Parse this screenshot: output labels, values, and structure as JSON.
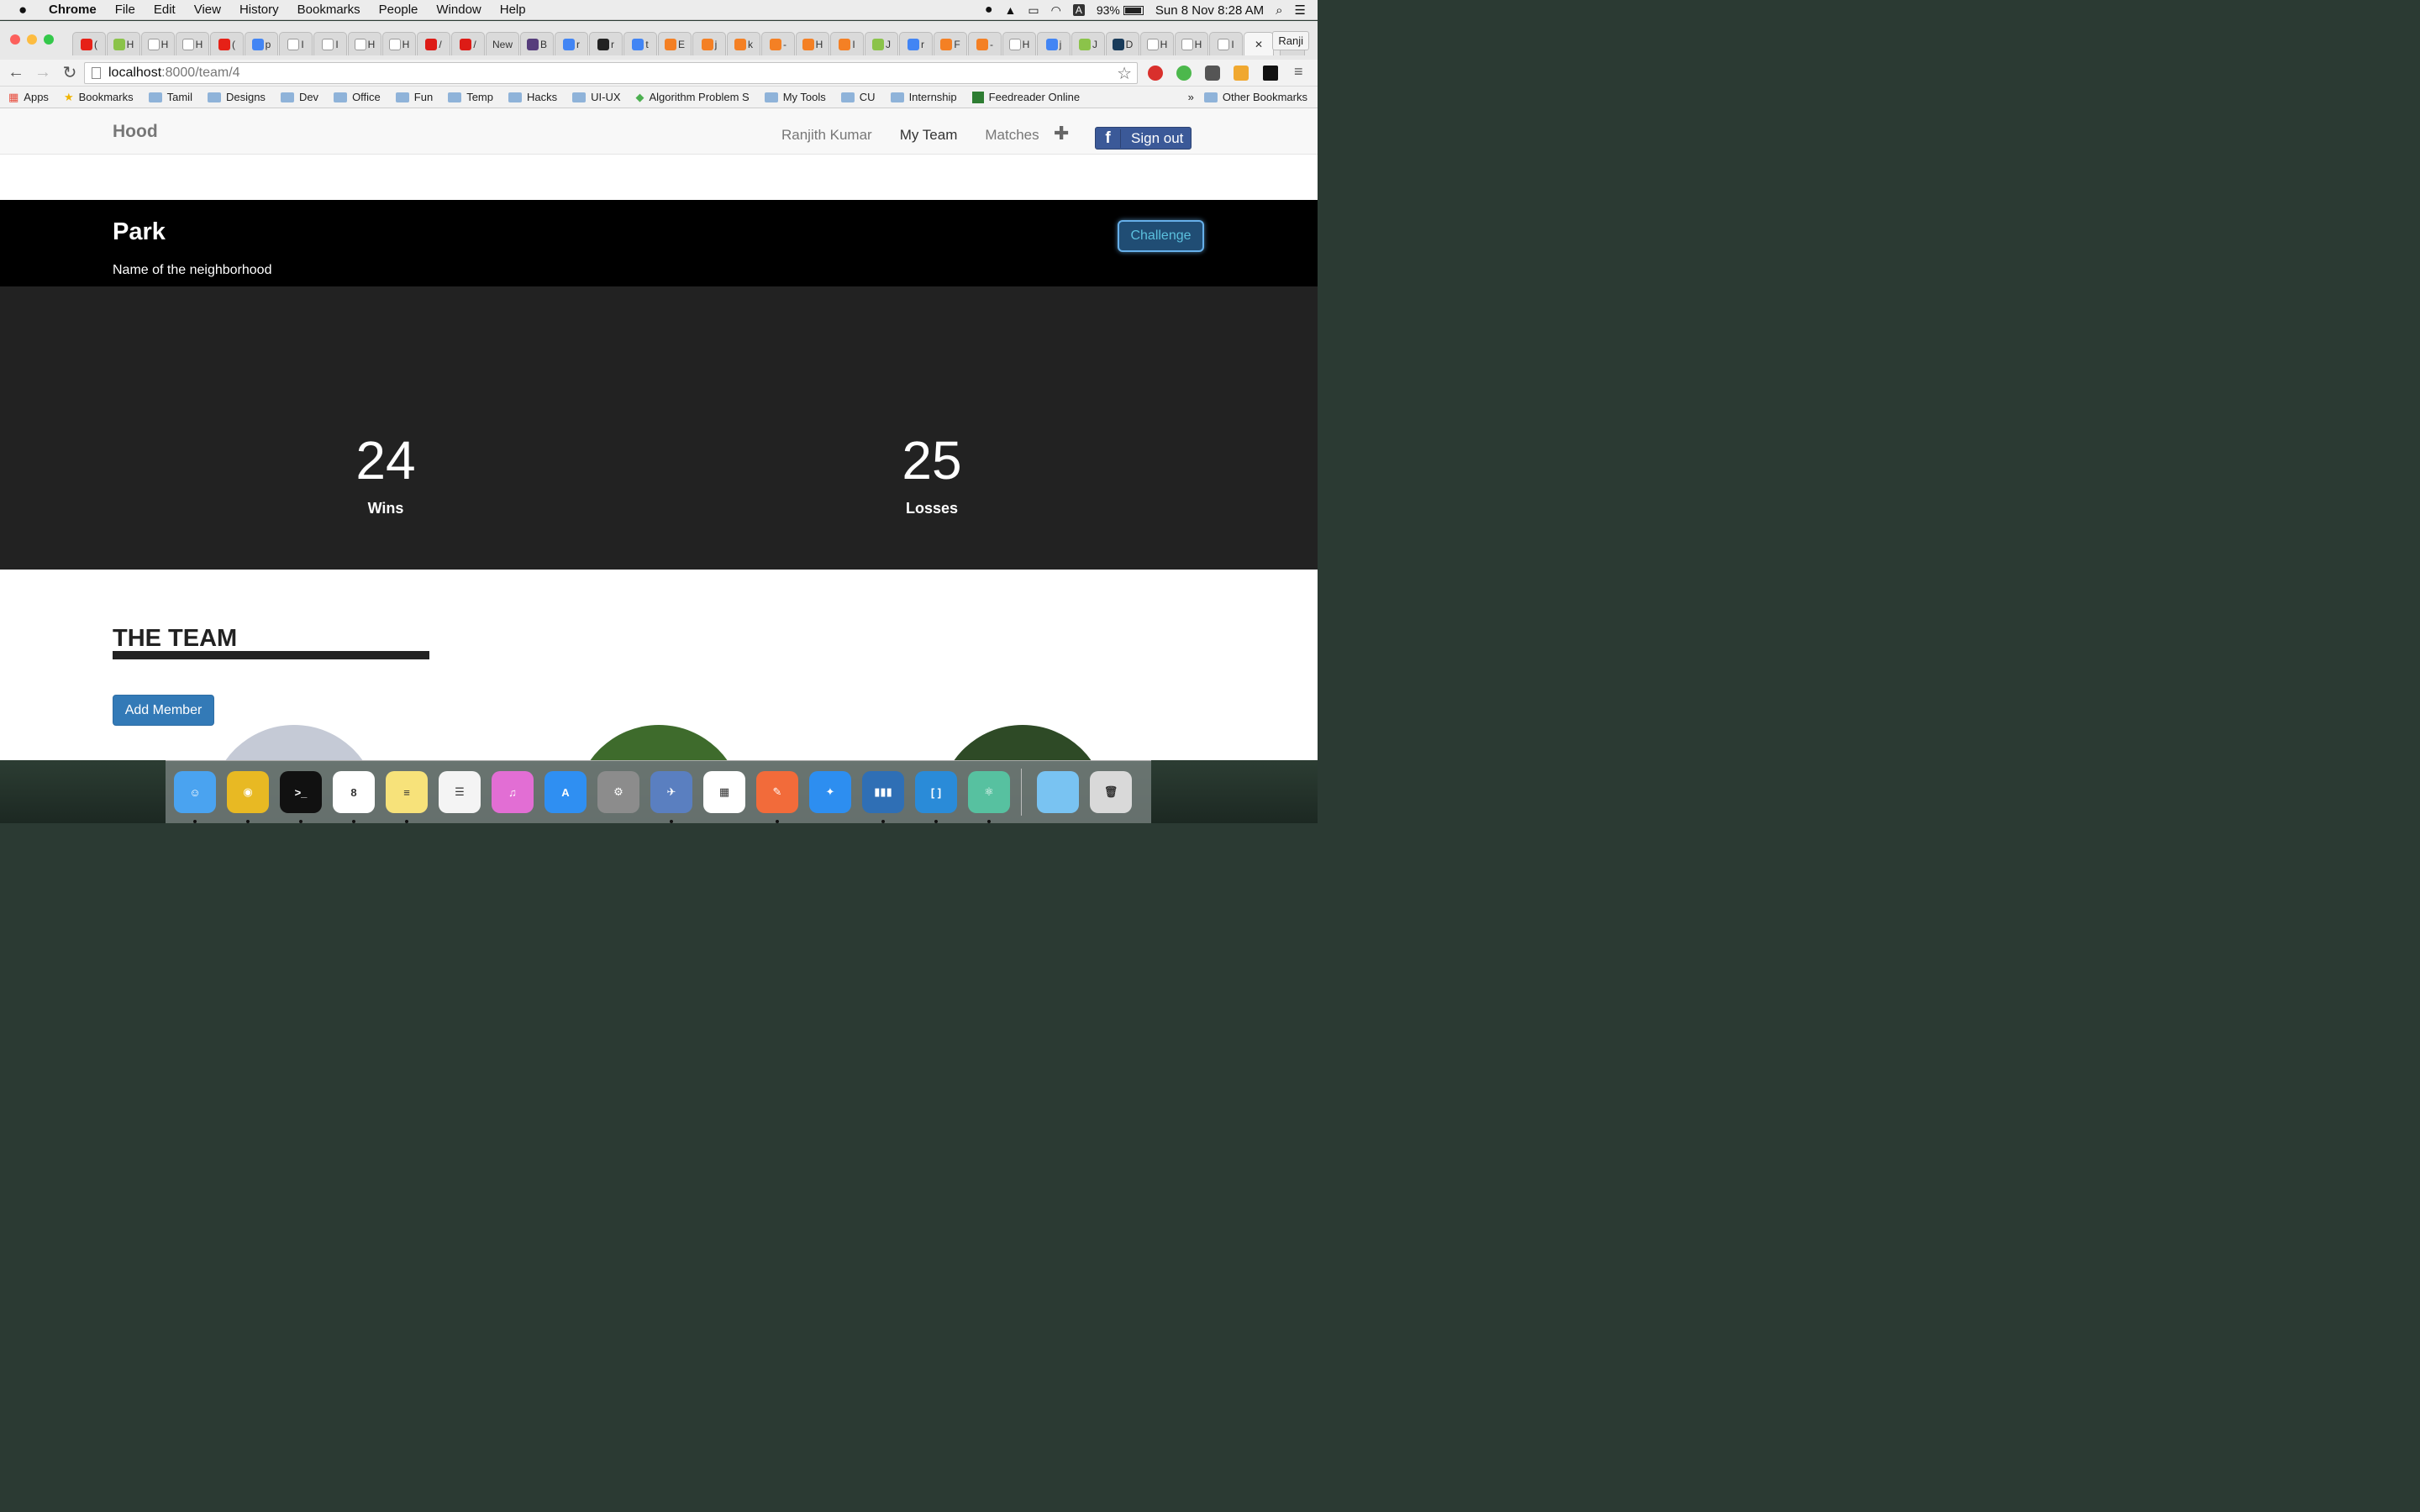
{
  "menubar": {
    "apple": "",
    "items": [
      "Chrome",
      "File",
      "Edit",
      "View",
      "History",
      "Bookmarks",
      "People",
      "Window",
      "Help"
    ],
    "battery": "93%",
    "datetime": "Sun 8 Nov  8:28 AM",
    "input_source": "A"
  },
  "browser": {
    "tabs": [
      {
        "label": "(",
        "color": "#e62117"
      },
      {
        "label": "H",
        "color": "#8bc34a"
      },
      {
        "label": "H",
        "color": "#ffffff"
      },
      {
        "label": "H",
        "color": "#ffffff"
      },
      {
        "label": "(",
        "color": "#e62117"
      },
      {
        "label": "p",
        "color": "#4285f4"
      },
      {
        "label": "I",
        "color": "#ffffff"
      },
      {
        "label": "I",
        "color": "#ffffff"
      },
      {
        "label": "H",
        "color": "#ffffff"
      },
      {
        "label": "H",
        "color": "#ffffff"
      },
      {
        "label": "/",
        "color": "#dd1b16"
      },
      {
        "label": "/",
        "color": "#dd1b16"
      },
      {
        "label": "New",
        "color": ""
      },
      {
        "label": "B",
        "color": "#563d7c"
      },
      {
        "label": "r",
        "color": "#4285f4"
      },
      {
        "label": "r",
        "color": "#222222"
      },
      {
        "label": "t",
        "color": "#4285f4"
      },
      {
        "label": "E",
        "color": "#f48024"
      },
      {
        "label": "j",
        "color": "#f48024"
      },
      {
        "label": "k",
        "color": "#f48024"
      },
      {
        "label": "-",
        "color": "#f48024"
      },
      {
        "label": "H",
        "color": "#f48024"
      },
      {
        "label": "I",
        "color": "#f48024"
      },
      {
        "label": "J",
        "color": "#8bc34a"
      },
      {
        "label": "r",
        "color": "#4285f4"
      },
      {
        "label": "F",
        "color": "#f48024"
      },
      {
        "label": "-",
        "color": "#f48024"
      },
      {
        "label": "H",
        "color": "#ffffff"
      },
      {
        "label": "j",
        "color": "#4285f4"
      },
      {
        "label": "J",
        "color": "#8bc34a"
      },
      {
        "label": "D",
        "color": "#1a3c5b"
      },
      {
        "label": "H",
        "color": "#ffffff"
      },
      {
        "label": "H",
        "color": "#ffffff"
      },
      {
        "label": "I",
        "color": "#ffffff"
      }
    ],
    "close_tab": "✕",
    "profile": "Ranji",
    "url_host": "localhost",
    "url_path": ":8000/team/4",
    "bookmarks": [
      "Apps",
      "Bookmarks",
      "Tamil",
      "Designs",
      "Dev",
      "Office",
      "Fun",
      "Temp",
      "Hacks",
      "UI-UX",
      "Algorithm Problem S",
      "My Tools",
      "CU",
      "Internship",
      "Feedreader Online"
    ],
    "more_bookmarks": "»",
    "other_bookmarks": "Other Bookmarks"
  },
  "app": {
    "brand": "Hood",
    "nav": [
      "Ranjith Kumar",
      "My Team",
      "Matches"
    ],
    "active_nav": "My Team",
    "plus": "✚",
    "signout": "Sign out",
    "fb": "f",
    "team_name": "Park",
    "team_subtitle": "Name of the neighborhood",
    "challenge": "Challenge",
    "wins": "24",
    "wins_label": "Wins",
    "losses": "25",
    "losses_label": "Losses",
    "section_title": "THE TEAM",
    "add_member": "Add Member"
  },
  "dock": [
    {
      "name": "finder",
      "color": "#4aa3f0",
      "glyph": "☺"
    },
    {
      "name": "chrome",
      "color": "#e8b923",
      "glyph": "◉"
    },
    {
      "name": "terminal",
      "color": "#111111",
      "glyph": ">_"
    },
    {
      "name": "calendar",
      "color": "#ffffff",
      "glyph": "8"
    },
    {
      "name": "notes",
      "color": "#f7e27a",
      "glyph": "≡"
    },
    {
      "name": "reminders",
      "color": "#f4f4f4",
      "glyph": "☰"
    },
    {
      "name": "itunes",
      "color": "#e26ed4",
      "glyph": "♫"
    },
    {
      "name": "app-store",
      "color": "#2f8ff2",
      "glyph": "A"
    },
    {
      "name": "system-preferences",
      "color": "#8c8c8c",
      "glyph": "⚙"
    },
    {
      "name": "cyberduck",
      "color": "#5a7fc0",
      "glyph": "✈"
    },
    {
      "name": "launchpad",
      "color": "#ffffff",
      "glyph": "▦"
    },
    {
      "name": "sketch-pen",
      "color": "#f26b3a",
      "glyph": "✎"
    },
    {
      "name": "safari",
      "color": "#2d8ef0",
      "glyph": "✦"
    },
    {
      "name": "activity-monitor",
      "color": "#2f6fb5",
      "glyph": "▮▮▮"
    },
    {
      "name": "brackets",
      "color": "#2a8bd8",
      "glyph": "[ ]"
    },
    {
      "name": "atom",
      "color": "#57c1a0",
      "glyph": "⚛"
    },
    {
      "name": "downloads-folder",
      "color": "#79c3f2",
      "glyph": ""
    },
    {
      "name": "trash",
      "color": "#d9d9d9",
      "glyph": "🗑"
    }
  ]
}
